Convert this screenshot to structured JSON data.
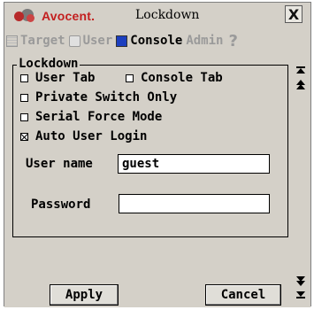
{
  "window": {
    "brand": "Avocent.",
    "title": "Lockdown",
    "close_label": "X"
  },
  "tabs": [
    {
      "label": "Target",
      "icon": "target-icon",
      "active": false
    },
    {
      "label": "User",
      "icon": "user-icon",
      "active": false
    },
    {
      "label": "Console",
      "icon": "console-icon",
      "active": true
    },
    {
      "label": "Admin",
      "icon": "",
      "active": false
    }
  ],
  "help_label": "?",
  "lockdown": {
    "legend": "Lockdown",
    "user_tab": {
      "label": "User Tab",
      "checked": false
    },
    "console_tab": {
      "label": "Console Tab",
      "checked": false
    },
    "private_switch": {
      "label": "Private Switch Only",
      "checked": false
    },
    "serial_force": {
      "label": "Serial Force Mode",
      "checked": false
    },
    "auto_login": {
      "label": "Auto User Login",
      "checked": true
    },
    "username_label": "User name",
    "username_value": "guest",
    "password_label": "Password",
    "password_value": ""
  },
  "buttons": {
    "apply": "Apply",
    "cancel": "Cancel"
  },
  "colors": {
    "brand": "#c31f1f",
    "panel_bg": "#d4d0c8",
    "console_icon": "#1c3fbf",
    "disabled_text": "#9a9a9a"
  }
}
